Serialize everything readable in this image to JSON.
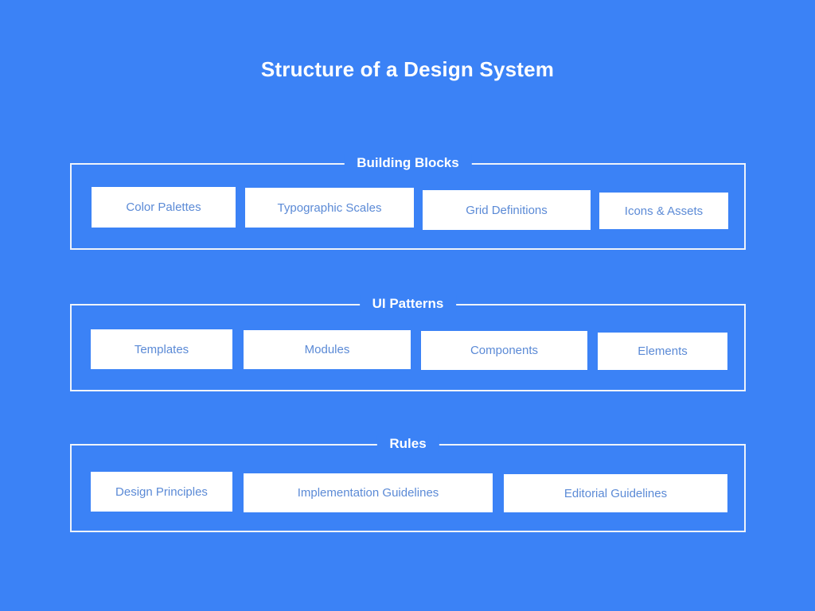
{
  "slide": {
    "title": "Structure of a Design System",
    "background_color": "#3b82f6",
    "frame_color": "#eef3fb",
    "card_background": "#ffffff",
    "card_text_color": "#5b8ad6",
    "title_color": "#ffffff"
  },
  "diagram": {
    "type": "grouped-blocks",
    "groups": [
      {
        "label": "Building Blocks",
        "cards": [
          {
            "label": "Color Palettes"
          },
          {
            "label": "Typographic Scales"
          },
          {
            "label": "Grid Definitions"
          },
          {
            "label": "Icons & Assets"
          }
        ]
      },
      {
        "label": "UI Patterns",
        "cards": [
          {
            "label": "Templates"
          },
          {
            "label": "Modules"
          },
          {
            "label": "Components"
          },
          {
            "label": "Elements"
          }
        ]
      },
      {
        "label": "Rules",
        "cards": [
          {
            "label": "Design Principles"
          },
          {
            "label": "Implementation Guidelines"
          },
          {
            "label": "Editorial Guidelines"
          }
        ]
      }
    ]
  }
}
